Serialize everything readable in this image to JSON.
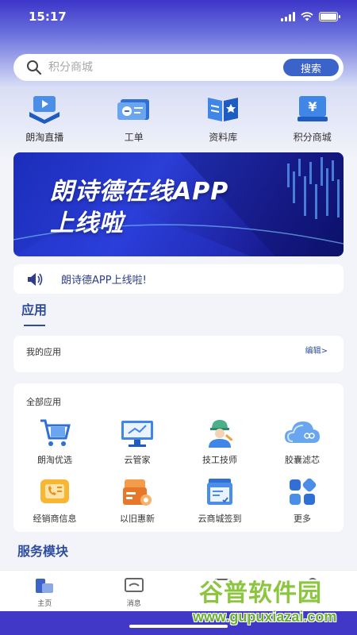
{
  "status_bar": {
    "time": "15:17"
  },
  "search": {
    "placeholder": "积分商城",
    "button_label": "搜索"
  },
  "quick_nav": [
    {
      "label": "朗淘直播",
      "icon": "live-stream-icon"
    },
    {
      "label": "工单",
      "icon": "work-order-icon"
    },
    {
      "label": "资料库",
      "icon": "library-icon"
    },
    {
      "label": "积分商城",
      "icon": "points-mall-icon"
    }
  ],
  "banner": {
    "line1": "朗诗德在线APP",
    "line2": "上线啦"
  },
  "notice": {
    "text": "朗诗德APP上线啦!",
    "icon": "speaker-icon"
  },
  "apps_section": {
    "title": "应用",
    "my_apps_label": "我的应用",
    "edit_label": "编辑>"
  },
  "all_apps": {
    "label": "全部应用",
    "items": [
      {
        "label": "朗淘优选",
        "icon": "shopping-cart-icon"
      },
      {
        "label": "云管家",
        "icon": "cloud-manager-icon"
      },
      {
        "label": "技工技师",
        "icon": "technician-icon"
      },
      {
        "label": "胶囊滤芯",
        "icon": "capsule-filter-icon"
      },
      {
        "label": "经销商信息",
        "icon": "dealer-info-icon"
      },
      {
        "label": "以旧惠新",
        "icon": "trade-in-icon"
      },
      {
        "label": "云商城签到",
        "icon": "checkin-icon"
      },
      {
        "label": "更多",
        "icon": "more-icon"
      }
    ]
  },
  "service_section": {
    "title": "服务模块"
  },
  "tab_bar": [
    {
      "label": "主页",
      "icon": "home-icon"
    },
    {
      "label": "消息",
      "icon": "message-icon"
    },
    {
      "label": "",
      "icon": "scan-icon"
    },
    {
      "label": "",
      "icon": "profile-icon"
    }
  ],
  "watermark": {
    "main": "谷普软件园",
    "url": "www.gupuxiazai.com"
  },
  "colors": {
    "primary": "#2e4da0",
    "header": "#3d35c9",
    "button": "#3b63c9",
    "watermark": "#8cc63f"
  }
}
